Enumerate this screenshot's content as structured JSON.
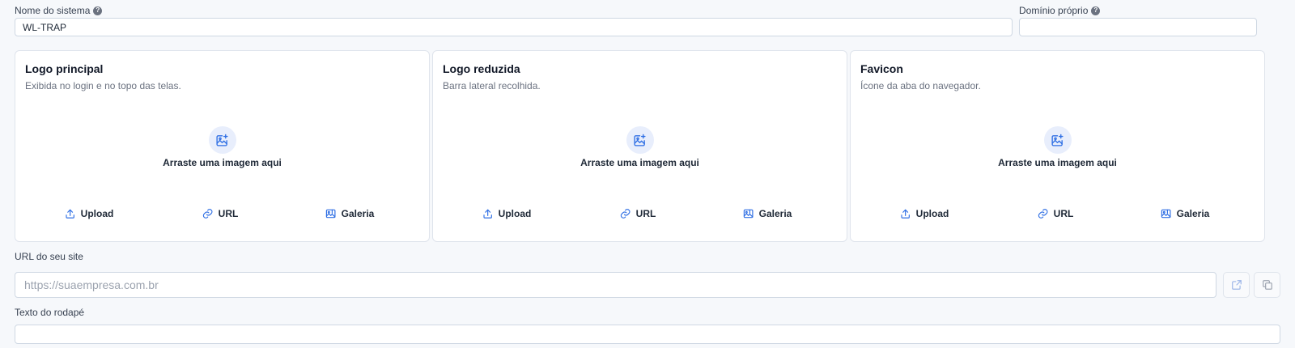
{
  "fields": {
    "system_name": {
      "label": "Nome do sistema",
      "value": "WL-TRAP"
    },
    "own_domain": {
      "label": "Domínio próprio",
      "value": ""
    },
    "site_url": {
      "label": "URL do seu site",
      "placeholder": "https://suaempresa.com.br"
    },
    "footer_text": {
      "label": "Texto do rodapé",
      "value": ""
    }
  },
  "cards": [
    {
      "title": "Logo principal",
      "description": "Exibida no login e no topo das telas.",
      "drop_text": "Arraste uma imagem aqui",
      "actions": {
        "upload": "Upload",
        "url": "URL",
        "gallery": "Galeria"
      }
    },
    {
      "title": "Logo reduzida",
      "description": "Barra lateral recolhida.",
      "drop_text": "Arraste uma imagem aqui",
      "actions": {
        "upload": "Upload",
        "url": "URL",
        "gallery": "Galeria"
      }
    },
    {
      "title": "Favicon",
      "description": "Ícone da aba do navegador.",
      "drop_text": "Arraste uma imagem aqui",
      "actions": {
        "upload": "Upload",
        "url": "URL",
        "gallery": "Galeria"
      }
    }
  ],
  "icons": {
    "help": "question-circle-icon",
    "image_add": "image-plus-icon",
    "upload": "upload-icon",
    "link": "link-icon",
    "gallery": "gallery-icon",
    "open_external": "external-link-icon",
    "copy": "copy-icon"
  },
  "colors": {
    "accent": "#2f6fe4",
    "background": "#f6f8fb",
    "card_border": "#dfe4ec"
  }
}
